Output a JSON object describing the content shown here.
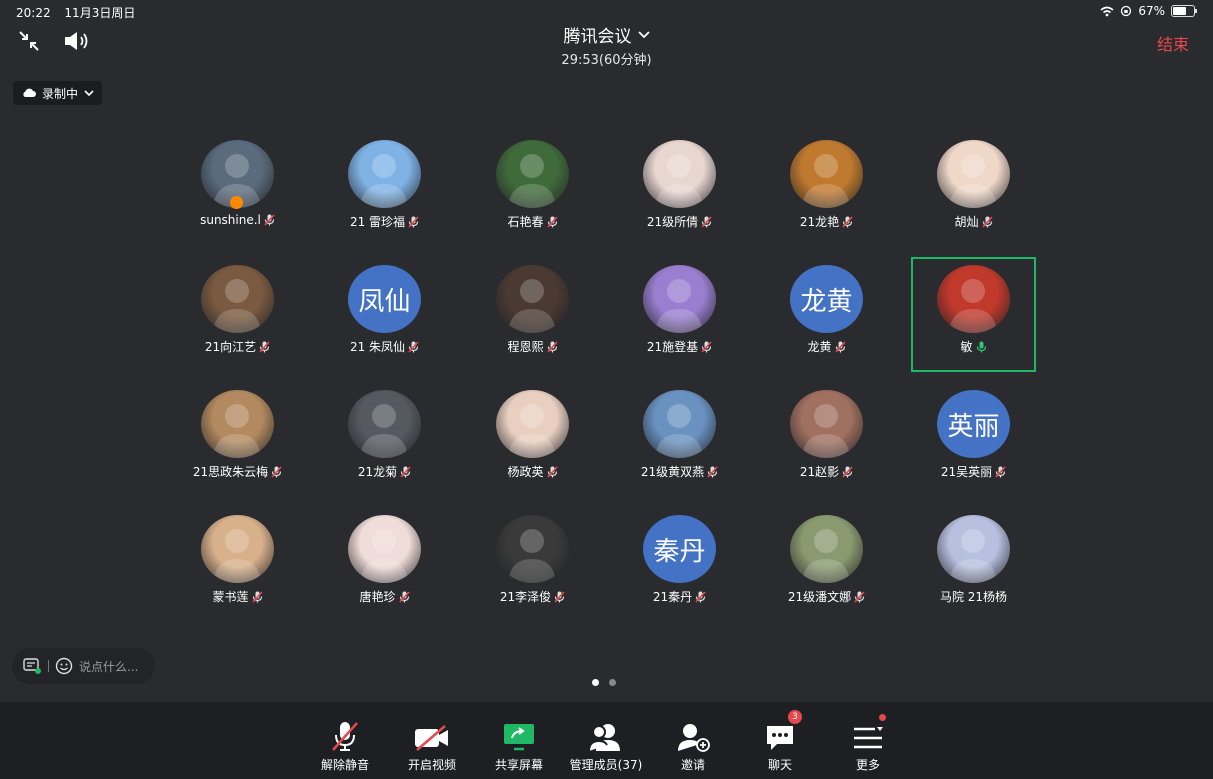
{
  "status": {
    "time": "20:22",
    "date": "11月3日周日",
    "battery": "67%",
    "battery_level": 0.67
  },
  "header": {
    "title": "腾讯会议",
    "timer": "29:53(60分钟)",
    "end_label": "结束"
  },
  "recording": {
    "label": "录制中"
  },
  "participants": [
    {
      "name": "sunshine.l",
      "avatar": "photo",
      "color": "#5a6b7d",
      "host": true,
      "mic": "muted"
    },
    {
      "name": "21 雷珍福",
      "avatar": "photo",
      "color": "#7fb3e6",
      "mic": "muted"
    },
    {
      "name": "石艳春",
      "avatar": "photo",
      "color": "#3f6b3a",
      "mic": "muted"
    },
    {
      "name": "21级所倩",
      "avatar": "photo",
      "color": "#e8d6d0",
      "mic": "muted"
    },
    {
      "name": "21龙艳",
      "avatar": "photo",
      "color": "#c07a2f",
      "mic": "muted"
    },
    {
      "name": "胡灿",
      "avatar": "photo",
      "color": "#f0d8c8",
      "mic": "muted"
    },
    {
      "name": "21向江艺",
      "avatar": "photo",
      "color": "#7a5a40",
      "mic": "muted"
    },
    {
      "name": "21 朱凤仙",
      "avatar": "text",
      "initials": "凤仙",
      "mic": "muted"
    },
    {
      "name": "程恩熙",
      "avatar": "photo",
      "color": "#4a3a32",
      "mic": "muted"
    },
    {
      "name": "21施登基",
      "avatar": "photo",
      "color": "#9a7fd0",
      "mic": "muted"
    },
    {
      "name": "龙黄",
      "avatar": "text",
      "initials": "龙黄",
      "mic": "muted"
    },
    {
      "name": "敏",
      "avatar": "photo",
      "color": "#c0392b",
      "mic": "active"
    },
    {
      "name": "21思政朱云梅",
      "avatar": "photo",
      "color": "#b38a60",
      "mic": "muted"
    },
    {
      "name": "21龙菊",
      "avatar": "photo",
      "color": "#555a60",
      "mic": "muted"
    },
    {
      "name": "杨政英",
      "avatar": "photo",
      "color": "#e8cfc0",
      "mic": "muted"
    },
    {
      "name": "21级黄双燕",
      "avatar": "photo",
      "color": "#6a92c0",
      "mic": "muted"
    },
    {
      "name": "21赵影",
      "avatar": "photo",
      "color": "#a07060",
      "mic": "muted"
    },
    {
      "name": "21吴英丽",
      "avatar": "text",
      "initials": "英丽",
      "mic": "muted"
    },
    {
      "name": "蒙书莲",
      "avatar": "photo",
      "color": "#d8b08a",
      "mic": "muted"
    },
    {
      "name": "唐艳珍",
      "avatar": "photo",
      "color": "#f0dcd8",
      "mic": "muted"
    },
    {
      "name": "21李泽俊",
      "avatar": "photo",
      "color": "#3a3a3a",
      "mic": "muted"
    },
    {
      "name": "21秦丹",
      "avatar": "text",
      "initials": "秦丹",
      "mic": "muted"
    },
    {
      "name": "21级潘文娜",
      "avatar": "photo",
      "color": "#8a9a70",
      "mic": "muted"
    },
    {
      "name": "马院 21杨杨",
      "avatar": "photo",
      "color": "#b8c0e0",
      "mic": "none"
    }
  ],
  "chat": {
    "placeholder": "说点什么..."
  },
  "toolbar": {
    "unmute": "解除静音",
    "video": "开启视频",
    "share": "共享屏幕",
    "members": "管理成员(37)",
    "invite": "邀请",
    "chat": "聊天",
    "chat_badge": "3",
    "more": "更多"
  },
  "colors": {
    "bg": "#2a2b2f",
    "accent": "#1fb864",
    "end": "#e5484d",
    "avatar_text_bg": "#4472c4"
  }
}
